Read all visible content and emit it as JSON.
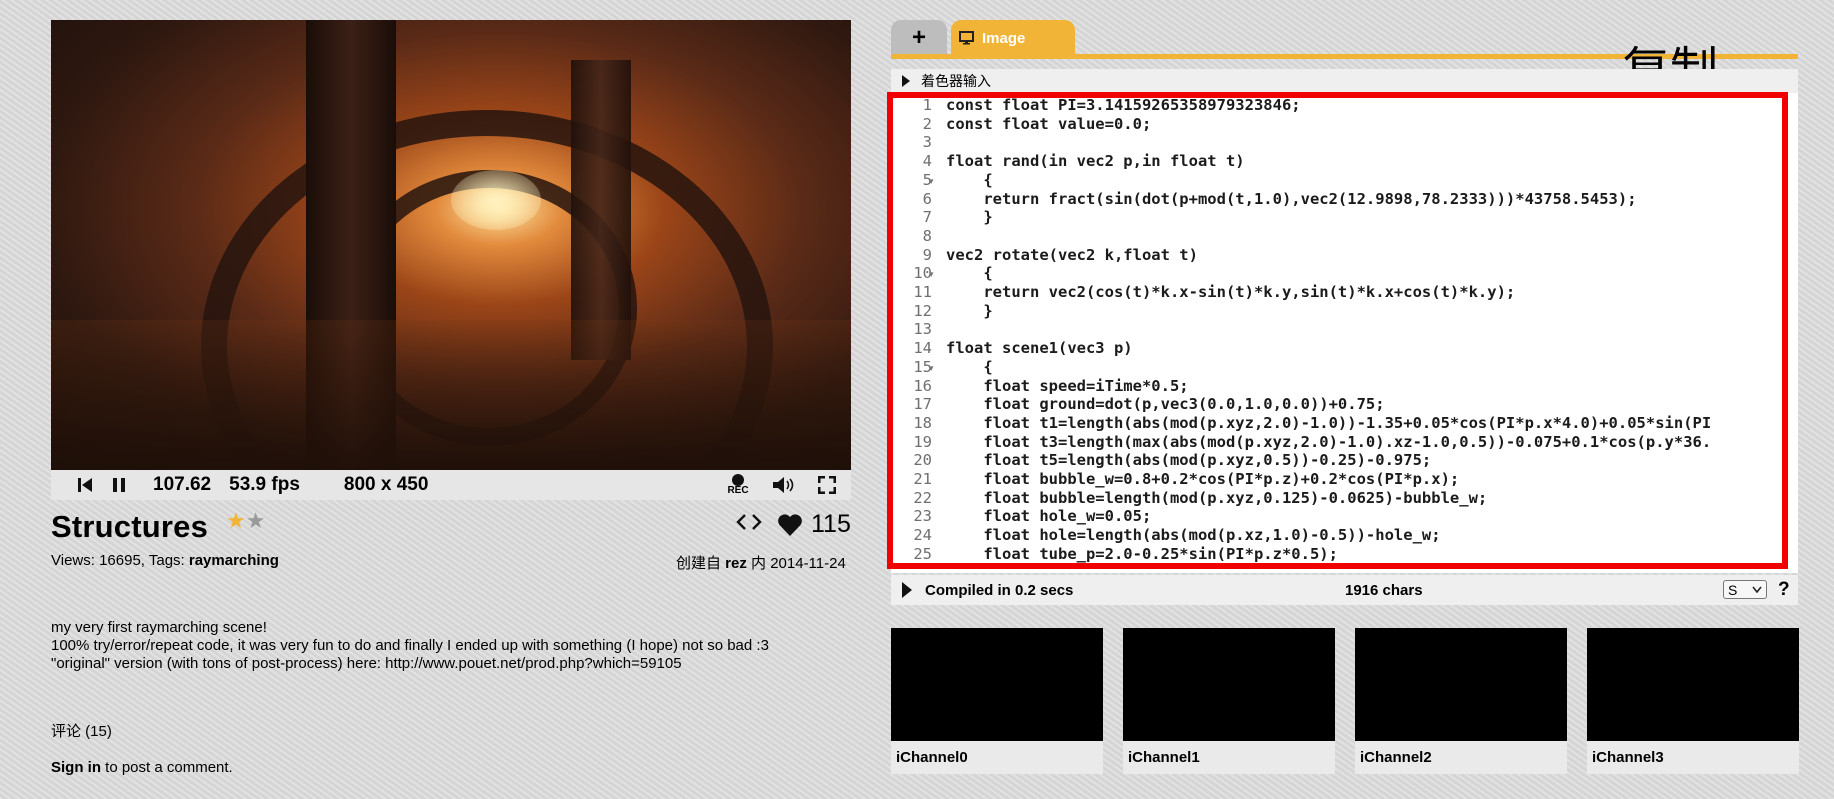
{
  "player": {
    "time": "107.62",
    "fps": "53.9 fps",
    "resolution": "800 x 450",
    "rec_label": "REC"
  },
  "shader": {
    "title": "Structures",
    "views_label": "Views: 16695, Tags: ",
    "tag": "raymarching",
    "likes": "115",
    "created_prefix": "创建自 ",
    "author": "rez",
    "created_suffix": " 内 2014-11-24",
    "description": [
      "my very first raymarching scene!",
      "100% try/error/repeat code, it was very fun to do and finally I ended up with something (I hope) not so bad :3",
      "\"original\" version (with tons of post-process) here: http://www.pouet.net/prod.php?which=59105"
    ],
    "comments_label": "评论 (15)",
    "signin_link": "Sign in",
    "signin_rest": " to post a comment."
  },
  "editor": {
    "add_tab": "+",
    "tab_label": "Image",
    "shader_inputs_label": "着色器输入",
    "overlay_text": "复制",
    "compiled_label": "Compiled in 0.2 secs",
    "chars_label": "1916 chars",
    "font_size_option": "S",
    "help_label": "?",
    "lines": [
      {
        "n": "1",
        "t": "const float PI=3.14159265358979323846;"
      },
      {
        "n": "2",
        "t": "const float value=0.0;"
      },
      {
        "n": "3",
        "t": ""
      },
      {
        "n": "4",
        "t": "float rand(in vec2 p,in float t)"
      },
      {
        "n": "5",
        "t": "    {",
        "fold": true
      },
      {
        "n": "6",
        "t": "    return fract(sin(dot(p+mod(t,1.0),vec2(12.9898,78.2333)))*43758.5453);"
      },
      {
        "n": "7",
        "t": "    }"
      },
      {
        "n": "8",
        "t": ""
      },
      {
        "n": "9",
        "t": "vec2 rotate(vec2 k,float t)"
      },
      {
        "n": "10",
        "t": "    {",
        "fold": true
      },
      {
        "n": "11",
        "t": "    return vec2(cos(t)*k.x-sin(t)*k.y,sin(t)*k.x+cos(t)*k.y);"
      },
      {
        "n": "12",
        "t": "    }"
      },
      {
        "n": "13",
        "t": ""
      },
      {
        "n": "14",
        "t": "float scene1(vec3 p)"
      },
      {
        "n": "15",
        "t": "    {",
        "fold": true
      },
      {
        "n": "16",
        "t": "    float speed=iTime*0.5;"
      },
      {
        "n": "17",
        "t": "    float ground=dot(p,vec3(0.0,1.0,0.0))+0.75;"
      },
      {
        "n": "18",
        "t": "    float t1=length(abs(mod(p.xyz,2.0)-1.0))-1.35+0.05*cos(PI*p.x*4.0)+0.05*sin(PI"
      },
      {
        "n": "19",
        "t": "    float t3=length(max(abs(mod(p.xyz,2.0)-1.0).xz-1.0,0.5))-0.075+0.1*cos(p.y*36."
      },
      {
        "n": "20",
        "t": "    float t5=length(abs(mod(p.xyz,0.5))-0.25)-0.975;"
      },
      {
        "n": "21",
        "t": "    float bubble_w=0.8+0.2*cos(PI*p.z)+0.2*cos(PI*p.x);"
      },
      {
        "n": "22",
        "t": "    float bubble=length(mod(p.xyz,0.125)-0.0625)-bubble_w;"
      },
      {
        "n": "23",
        "t": "    float hole_w=0.05;"
      },
      {
        "n": "24",
        "t": "    float hole=length(abs(mod(p.xz,1.0)-0.5))-hole_w;"
      },
      {
        "n": "25",
        "t": "    float tube_p=2.0-0.25*sin(PI*p.z*0.5);"
      }
    ]
  },
  "channels": [
    "iChannel0",
    "iChannel1",
    "iChannel2",
    "iChannel3"
  ]
}
